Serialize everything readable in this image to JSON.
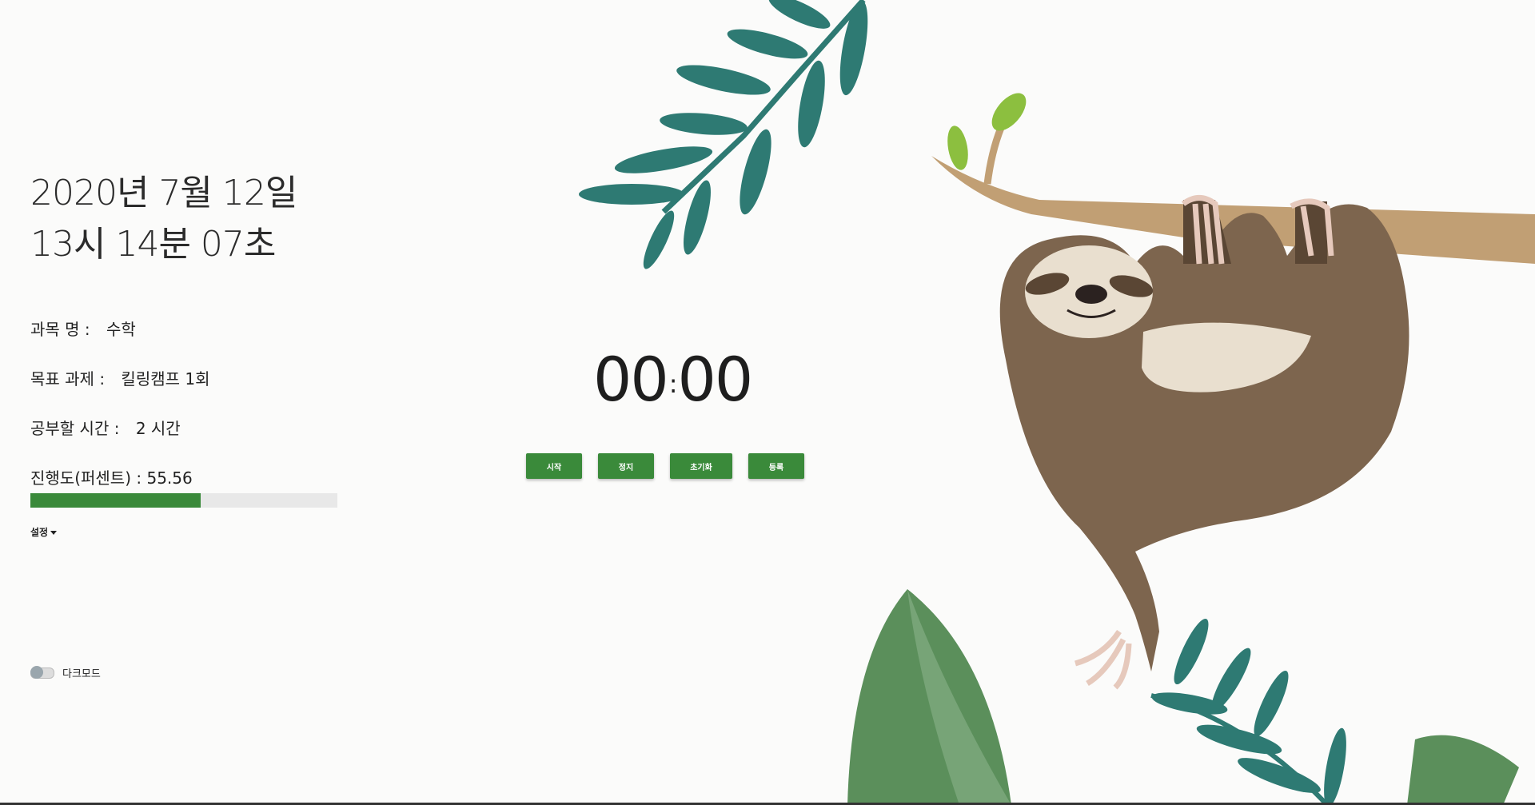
{
  "datetime": {
    "date": "2020년 7월 12일",
    "time": "13시 14분 07초"
  },
  "fields": [
    {
      "label": "과목 명 :",
      "value": "수학"
    },
    {
      "label": "목표 과제 :",
      "value": "킬링캠프 1회"
    },
    {
      "label": "공부할 시간 :",
      "value": "2 시간"
    }
  ],
  "progress": {
    "label": "진행도(퍼센트) :",
    "value": "55.56",
    "fraction": 0.5556
  },
  "settings": {
    "label": "설정"
  },
  "dark_mode": {
    "label": "다크모드",
    "on": false
  },
  "timer": {
    "minutes": "00",
    "seconds": "00"
  },
  "buttons": {
    "start": "시작",
    "stop": "정지",
    "reset": "초기화",
    "register": "등록"
  },
  "colors": {
    "accent": "#3a8a3a",
    "background": "#fbfbfa",
    "leaf_teal": "#2e7a73",
    "sloth_brown": "#7d654e"
  },
  "illustration": {
    "icon": "sloth-hanging-on-branch-illustration"
  }
}
